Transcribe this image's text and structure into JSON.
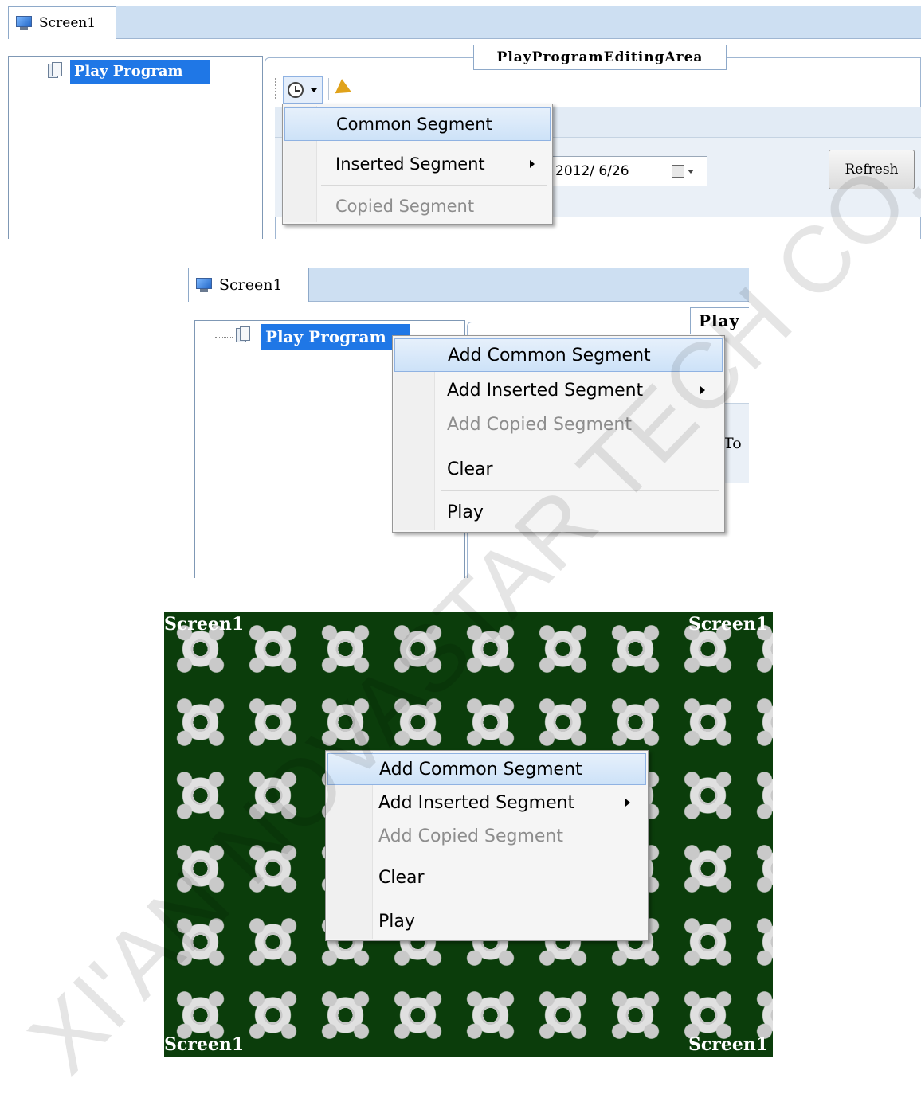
{
  "shot1": {
    "tab_label": "Screen1",
    "tree_root": "Play Program",
    "editing_area_title": "PlayProgramEditingArea",
    "date_value": "2012/ 6/26",
    "refresh_label": "Refresh",
    "toolbar": {
      "clock_icon": "clock-icon",
      "play_icon": "play-arrow-icon"
    },
    "menu": [
      {
        "label": "Common Segment",
        "state": "highlighted"
      },
      {
        "label": "Inserted Segment",
        "state": "normal",
        "submenu": true
      },
      {
        "label": "Copied Segment",
        "state": "disabled"
      }
    ]
  },
  "shot2": {
    "tab_label": "Screen1",
    "tree_root": "Play Program",
    "area_partial_title": "Play",
    "partial_to": "To",
    "menu": [
      {
        "label": "Add Common Segment",
        "state": "highlighted"
      },
      {
        "label": "Add Inserted Segment",
        "state": "normal",
        "submenu": true
      },
      {
        "label": "Add Copied Segment",
        "state": "disabled"
      },
      {
        "label": "Clear",
        "state": "normal"
      },
      {
        "label": "Play",
        "state": "normal"
      }
    ]
  },
  "shot3": {
    "corner_labels": [
      "Screen1",
      "Screen1",
      "Screen1",
      "Screen1"
    ],
    "menu": [
      {
        "label": "Add Common Segment",
        "state": "highlighted"
      },
      {
        "label": "Add Inserted Segment",
        "state": "normal",
        "submenu": true
      },
      {
        "label": "Add Copied Segment",
        "state": "disabled"
      },
      {
        "label": "Clear",
        "state": "normal"
      },
      {
        "label": "Play",
        "state": "normal"
      }
    ]
  },
  "watermark": {
    "line1": "XI'AN NOVASTAR TECH CO., LTD",
    "color": "#cfcfcf"
  }
}
